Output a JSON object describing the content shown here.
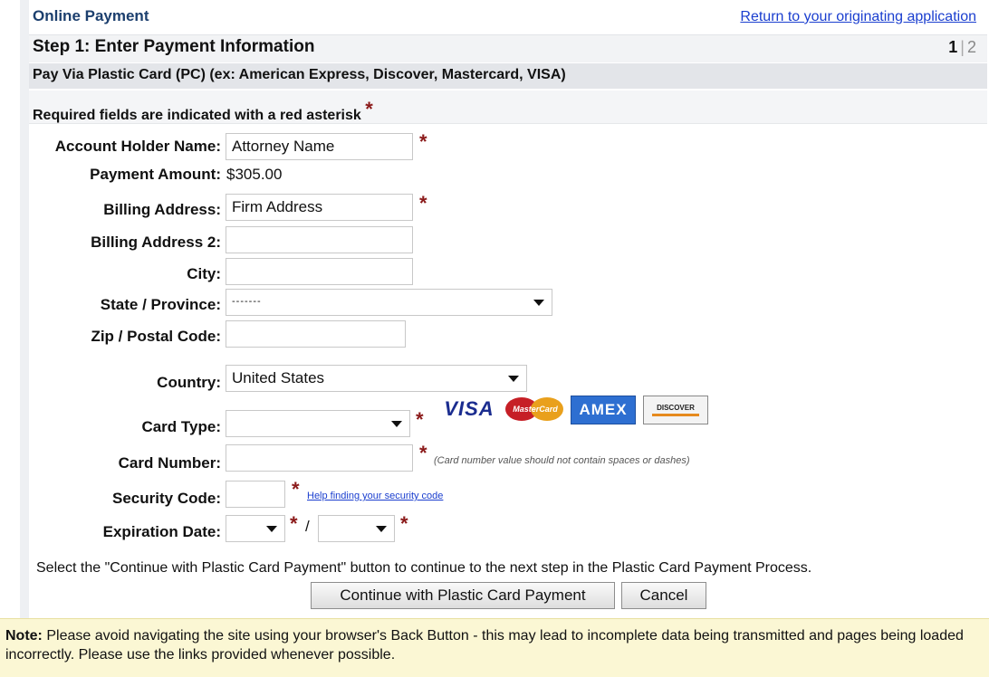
{
  "header": {
    "title": "Online Payment",
    "return_link": "Return to your originating application",
    "step_title": "Step 1: Enter Payment Information",
    "step_current": "1",
    "step_separator": "|",
    "step_other": "2"
  },
  "section": {
    "title": "Pay Via Plastic Card (PC) (ex: American Express, Discover, Mastercard, VISA)",
    "required_note": "Required fields are indicated with a red asterisk",
    "asterisk": "*"
  },
  "form": {
    "account_holder_label": "Account Holder Name:",
    "account_holder_value": "Attorney Name",
    "payment_amount_label": "Payment Amount:",
    "payment_amount_value": "$305.00",
    "billing_address_label": "Billing Address:",
    "billing_address_value": "Firm Address",
    "billing_address2_label": "Billing Address 2:",
    "billing_address2_value": "",
    "city_label": "City:",
    "city_value": "",
    "state_label": "State / Province:",
    "state_value": "-------",
    "zip_label": "Zip / Postal Code:",
    "zip_value": "",
    "country_label": "Country:",
    "country_value": "United States",
    "card_type_label": "Card Type:",
    "card_type_value": "",
    "card_number_label": "Card Number:",
    "card_number_value": "",
    "card_number_hint": "(Card number value should not contain spaces or dashes)",
    "security_code_label": "Security Code:",
    "security_code_value": "",
    "security_help_link": "Help finding your security code",
    "expiration_label": "Expiration Date:",
    "expiration_separator": "/"
  },
  "card_logos": [
    "VISA",
    "MasterCard",
    "AMEX",
    "DISCOVER"
  ],
  "instructions": "Select the \"Continue with Plastic Card Payment\" button to continue to the next step in the Plastic Card Payment Process.",
  "buttons": {
    "continue": "Continue with Plastic Card Payment",
    "cancel": "Cancel"
  },
  "note": {
    "label": "Note:",
    "text": "Please avoid navigating the site using your browser's Back Button - this may lead to incomplete data being transmitted and pages being loaded incorrectly. Please use the links provided whenever possible."
  },
  "colors": {
    "asterisk": "#8b1a1a",
    "link": "#1a3ecf",
    "header_title": "#1c3f6e",
    "note_background": "#fbf7d4"
  }
}
